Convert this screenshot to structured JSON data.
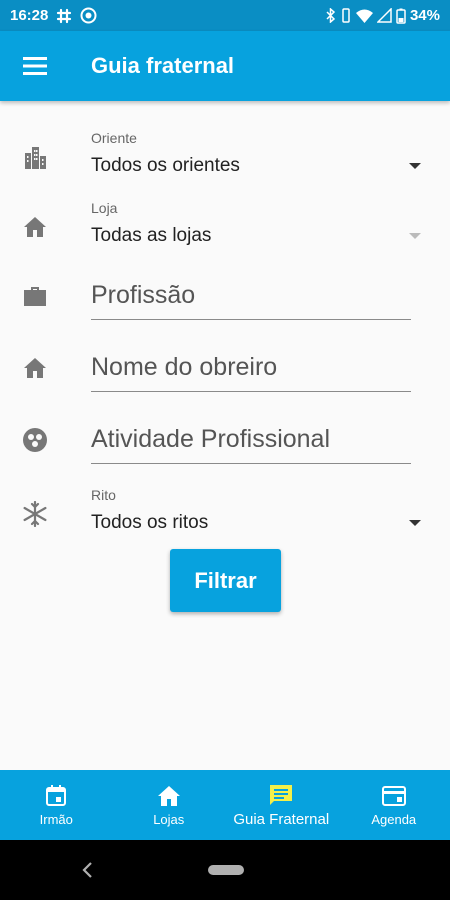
{
  "status_bar": {
    "time": "16:28",
    "battery": "34%"
  },
  "app_bar": {
    "title": "Guia fraternal"
  },
  "form": {
    "oriente": {
      "label": "Oriente",
      "value": "Todos os orientes"
    },
    "loja": {
      "label": "Loja",
      "value": "Todas as lojas"
    },
    "profissao": {
      "placeholder": "Profissão"
    },
    "nome_obreiro": {
      "placeholder": "Nome do obreiro"
    },
    "atividade": {
      "placeholder": "Atividade Profissional"
    },
    "rito": {
      "label": "Rito",
      "value": "Todos os ritos"
    },
    "submit_label": "Filtrar"
  },
  "bottom_nav": {
    "items": [
      {
        "label": "Irmão",
        "icon": "calendar-icon"
      },
      {
        "label": "Lojas",
        "icon": "home-icon"
      },
      {
        "label": "Guia Fraternal",
        "icon": "message-icon"
      },
      {
        "label": "Agenda",
        "icon": "card-icon"
      }
    ],
    "active_index": 2
  },
  "colors": {
    "primary": "#07a2de",
    "status_bar": "#0a8ec4",
    "active_icon": "#f3f04a"
  }
}
